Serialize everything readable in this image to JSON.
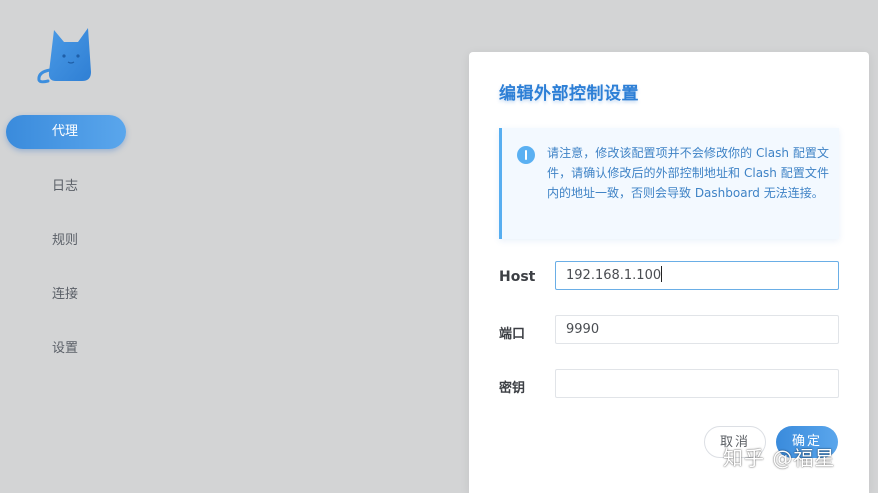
{
  "sidebar": {
    "items": [
      {
        "label": "代理",
        "active": true
      },
      {
        "label": "日志"
      },
      {
        "label": "规则"
      },
      {
        "label": "连接"
      },
      {
        "label": "设置"
      }
    ]
  },
  "dialog": {
    "title": "编辑外部控制设置",
    "notice": "请注意，修改该配置项并不会修改你的 Clash 配置文件，请确认修改后的外部控制地址和 Clash 配置文件内的地址一致，否则会导致 Dashboard 无法连接。",
    "fields": [
      {
        "label": "Host",
        "value": "192.168.1.100"
      },
      {
        "label": "端口",
        "value": "9990"
      },
      {
        "label": "密钥",
        "value": ""
      }
    ],
    "cancel_label": "取消",
    "confirm_label": "确定"
  },
  "watermark": "知乎 @福星",
  "colors": {
    "accent": "#3a8bdc",
    "background": "#d3d4d5",
    "notice_bg": "#f3f9ff"
  },
  "icons": {
    "logo": "cat-logo-icon",
    "notice": "info-icon"
  }
}
